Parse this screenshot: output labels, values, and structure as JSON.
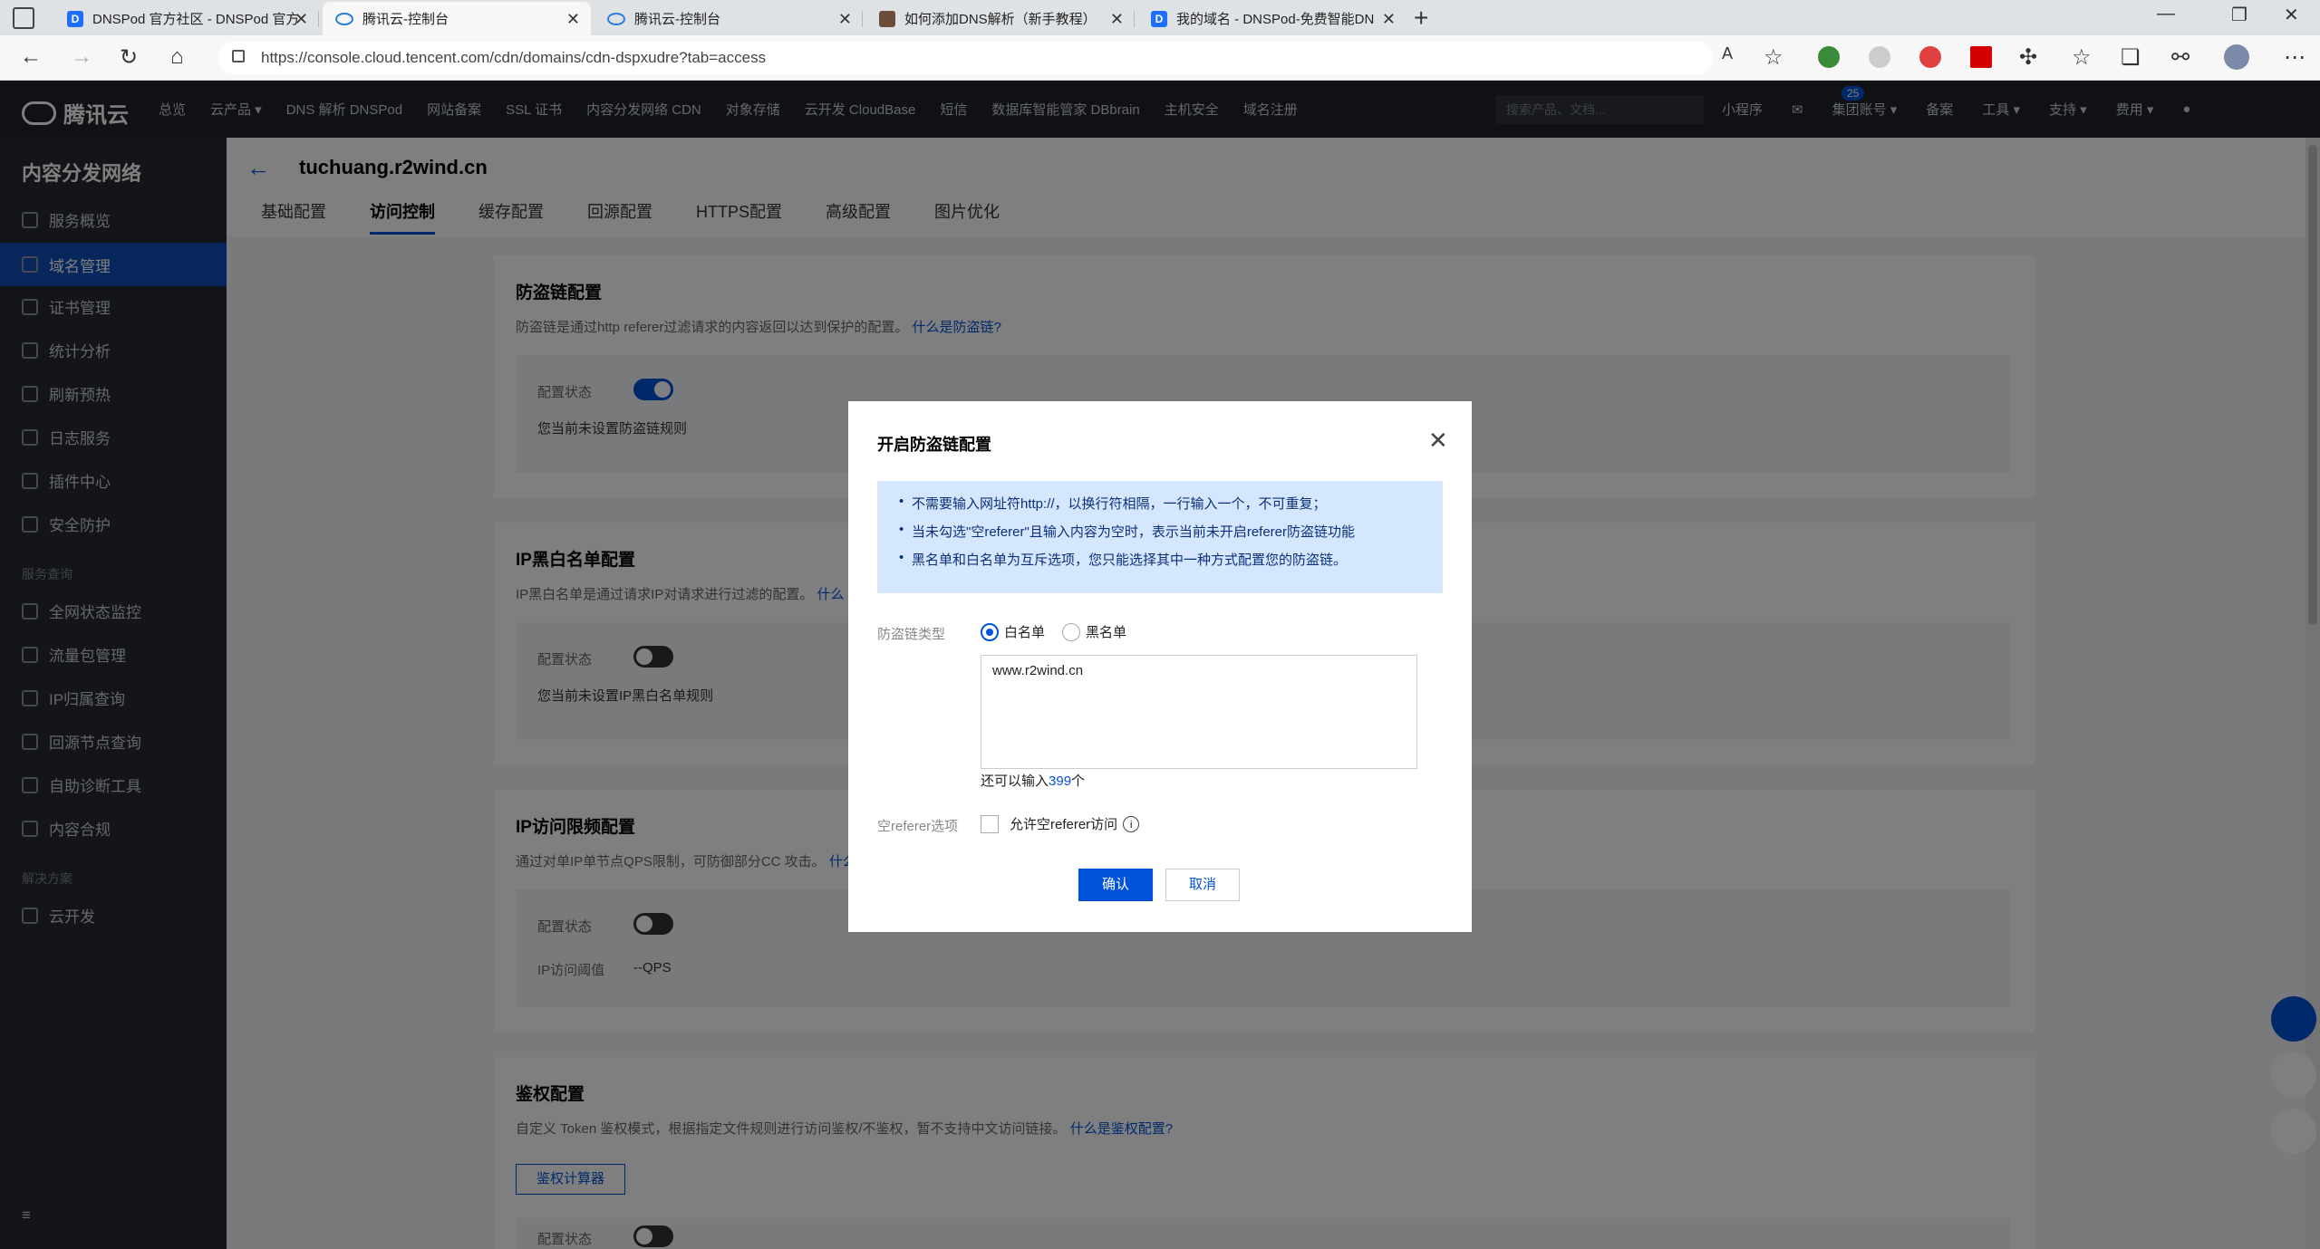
{
  "browser": {
    "tabs": [
      {
        "title": "DNSPod 官方社区 - DNSPod 官方"
      },
      {
        "title": "腾讯云-控制台"
      },
      {
        "title": "腾讯云-控制台"
      },
      {
        "title": "如何添加DNS解析（新手教程）"
      },
      {
        "title": "我的域名 - DNSPod-免费智能DN"
      }
    ],
    "url": "https://console.cloud.tencent.com/cdn/domains/cdn-dspxudre?tab=access"
  },
  "topnav": {
    "logo": "腾讯云",
    "items": [
      "总览",
      "云产品 ▾",
      "DNS 解析 DNSPod",
      "网站备案",
      "SSL 证书",
      "内容分发网络 CDN",
      "对象存储",
      "云开发 CloudBase",
      "短信",
      "数据库智能管家 DBbrain",
      "主机安全",
      "域名注册"
    ],
    "search_placeholder": "搜索产品、文档...",
    "right": [
      "小程序",
      "集团账号 ▾",
      "备案",
      "工具 ▾",
      "支持 ▾",
      "费用 ▾"
    ],
    "badge": "25"
  },
  "sidebar": {
    "title": "内容分发网络",
    "items": [
      "服务概览",
      "域名管理",
      "证书管理",
      "统计分析",
      "刷新预热",
      "日志服务",
      "插件中心",
      "安全防护"
    ],
    "group1": "服务查询",
    "items2": [
      "全网状态监控",
      "流量包管理",
      "IP归属查询",
      "回源节点查询",
      "自助诊断工具",
      "内容合规"
    ],
    "group2": "解决方案",
    "items3": [
      "云开发"
    ]
  },
  "page": {
    "domain": "tuchuang.r2wind.cn",
    "tabs": [
      "基础配置",
      "访问控制",
      "缓存配置",
      "回源配置",
      "HTTPS配置",
      "高级配置",
      "图片优化"
    ],
    "cards": {
      "hotlink": {
        "title": "防盗链配置",
        "desc": "防盗链是通过http referer过滤请求的内容返回以达到保护的配置。",
        "link": "什么是防盗链?",
        "status_label": "配置状态",
        "empty": "您当前未设置防盗链规则"
      },
      "ipbw": {
        "title": "IP黑白名单配置",
        "desc": "IP黑白名单是通过请求IP对请求进行过滤的配置。",
        "link": "什么",
        "status_label": "配置状态",
        "empty": "您当前未设置IP黑白名单规则"
      },
      "iprate": {
        "title": "IP访问限频配置",
        "desc": "通过对单IP单节点QPS限制，可防御部分CC 攻击。",
        "link": "什么",
        "status_label": "配置状态",
        "limit_label": "IP访问阈值",
        "limit_value": "--QPS"
      },
      "auth": {
        "title": "鉴权配置",
        "desc": "自定义 Token 鉴权模式，根据指定文件规则进行访问鉴权/不鉴权，暂不支持中文访问链接。",
        "link": "什么是鉴权配置?",
        "button": "鉴权计算器",
        "status_label": "配置状态"
      }
    }
  },
  "dialog": {
    "title": "开启防盗链配置",
    "info": [
      "不需要输入网址符http://，以换行符相隔，一行输入一个，不可重复；",
      "当未勾选\"空referer\"且输入内容为空时，表示当前未开启referer防盗链功能",
      "黑名单和白名单为互斥选项，您只能选择其中一种方式配置您的防盗链。"
    ],
    "type_label": "防盗链类型",
    "radio_white": "白名单",
    "radio_black": "黑名单",
    "textarea_value": "www.r2wind.cn",
    "remain_prefix": "还可以输入",
    "remain_count": "399",
    "remain_suffix": "个",
    "empty_label": "空referer选项",
    "checkbox_label": "允许空referer访问",
    "confirm": "确认",
    "cancel": "取消"
  },
  "colors": {
    "primary": "#0052d9",
    "overlay": "rgba(0,0,0,0.5)",
    "info_bg": "#d5e7ff"
  }
}
